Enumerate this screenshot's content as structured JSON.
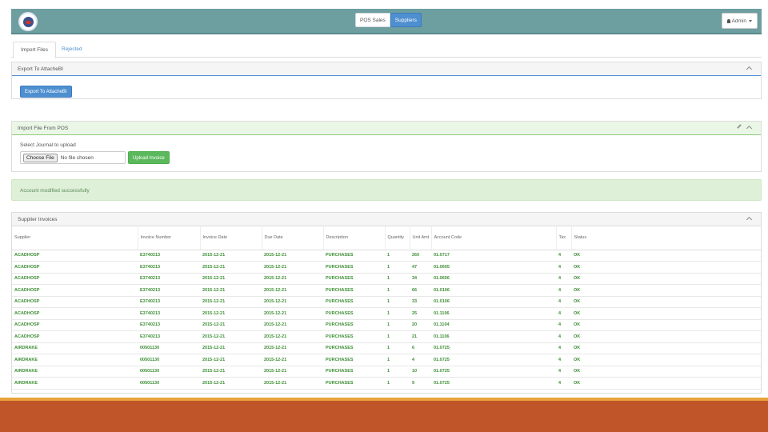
{
  "nav": {
    "buttons": [
      "POS Sales",
      "Suppliers"
    ],
    "admin_label": "Admin"
  },
  "tabs": [
    "Import Files",
    "Rejected"
  ],
  "export_panel": {
    "title": "Export To AttacheBI",
    "button": "Export To AttacheBI"
  },
  "import_panel": {
    "title": "Import File From POS",
    "prompt": "Select Journal to upload",
    "choose_button": "Choose File",
    "no_file": "No file chosen",
    "upload_button": "Upload Invoice"
  },
  "alert": "Account modified successfully",
  "invoices_panel": {
    "title": "Supplier Invoices",
    "columns": [
      "Supplier",
      "Invoice Number",
      "Invoice Date",
      "Due Date",
      "Description",
      "Quantity",
      "Unit Amt",
      "Account Code",
      "Tax",
      "Status"
    ],
    "rows": [
      [
        "ACADHOSP",
        "E3740213",
        "2015-12-21",
        "2015-12-21",
        "PURCHASES",
        "1",
        "260",
        "01.0717",
        "4",
        "OK"
      ],
      [
        "ACADHOSP",
        "E3740213",
        "2015-12-21",
        "2015-12-21",
        "PURCHASES",
        "1",
        "47",
        "01.0605",
        "4",
        "OK"
      ],
      [
        "ACADHOSP",
        "E3740213",
        "2015-12-21",
        "2015-12-21",
        "PURCHASES",
        "1",
        "34",
        "01.0606",
        "4",
        "OK"
      ],
      [
        "ACADHOSP",
        "E3740213",
        "2015-12-21",
        "2015-12-21",
        "PURCHASES",
        "1",
        "66",
        "01.0106",
        "4",
        "OK"
      ],
      [
        "ACADHOSP",
        "E3740213",
        "2015-12-21",
        "2015-12-21",
        "PURCHASES",
        "1",
        "33",
        "01.0106",
        "4",
        "OK"
      ],
      [
        "ACADHOSP",
        "E3740213",
        "2015-12-21",
        "2015-12-21",
        "PURCHASES",
        "1",
        "25",
        "01.1106",
        "4",
        "OK"
      ],
      [
        "ACADHOSP",
        "E3740213",
        "2015-12-21",
        "2015-12-21",
        "PURCHASES",
        "1",
        "20",
        "01.1104",
        "4",
        "OK"
      ],
      [
        "ACADHOSP",
        "E3740213",
        "2015-12-21",
        "2015-12-21",
        "PURCHASES",
        "1",
        "21",
        "01.1106",
        "4",
        "OK"
      ],
      [
        "AIRDRAKE",
        "00501130",
        "2015-12-21",
        "2015-12-21",
        "PURCHASES",
        "1",
        "6",
        "01.0725",
        "4",
        "OK"
      ],
      [
        "AIRDRAKE",
        "00501130",
        "2015-12-21",
        "2015-12-21",
        "PURCHASES",
        "1",
        "4",
        "01.0725",
        "4",
        "OK"
      ],
      [
        "AIRDRAKE",
        "00501130",
        "2015-12-21",
        "2015-12-21",
        "PURCHASES",
        "1",
        "10",
        "01.0725",
        "4",
        "OK"
      ],
      [
        "AIRDRAKE",
        "00501130",
        "2015-12-21",
        "2015-12-21",
        "PURCHASES",
        "1",
        "9",
        "01.0725",
        "4",
        "OK"
      ]
    ]
  },
  "colors": {
    "navbar": "#6d9ea0",
    "primary": "#4e8fd0",
    "success": "#5cb85c",
    "ok_text": "#3d8f35",
    "slide_bar": "#c0552a",
    "slide_accent": "#e8a33a"
  }
}
